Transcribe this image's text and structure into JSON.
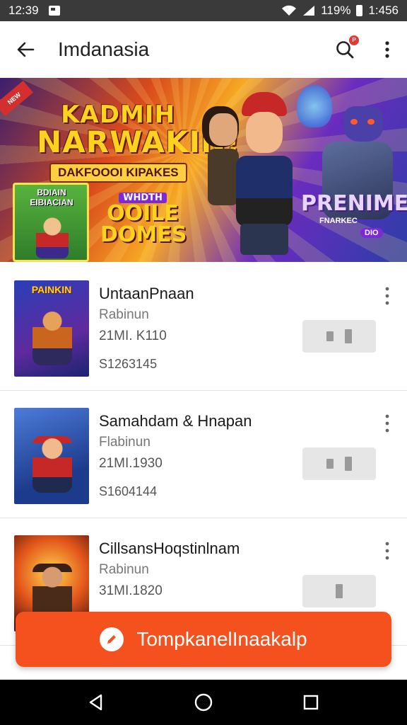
{
  "status_bar": {
    "time_left": "12:39",
    "battery": "119%",
    "time_right": "1:456"
  },
  "app_bar": {
    "title": "Imdanasia",
    "search_badge": "P"
  },
  "banner": {
    "ribbon": "NEW",
    "headline_1": "KADMIH",
    "headline_2": "NARWAKIN!",
    "subheadline": "DAKFOOOI KIPAKES",
    "card_text": "BDIAIN EIBIACIAN",
    "sub2_a": "WHDTH",
    "sub2_b": "OOILE",
    "sub2_c": "DOMES",
    "premium_title": "PRENIME",
    "premium_tag": "FNARKEC",
    "premium_badge": "DIO"
  },
  "items": [
    {
      "thumb_title": "PAINKIN",
      "title": "UntaanPnaan",
      "subtitle": "Rabinun",
      "size": "21MI. K110",
      "code": "S1263145"
    },
    {
      "thumb_title": "",
      "title": "Samahdam & Hnapan",
      "subtitle": "Flabinun",
      "size": "21MI.1930",
      "code": "S1604144"
    },
    {
      "thumb_title": "",
      "title": "CillsansHoqstinlnam",
      "subtitle": "Rabinun",
      "size": "31MI.1820",
      "code": ""
    }
  ],
  "fab": {
    "label": "TompkanelInaakalp"
  },
  "colors": {
    "accent": "#f4511e",
    "status_bar": "#3a3a3a",
    "nav_bar": "#000000"
  }
}
